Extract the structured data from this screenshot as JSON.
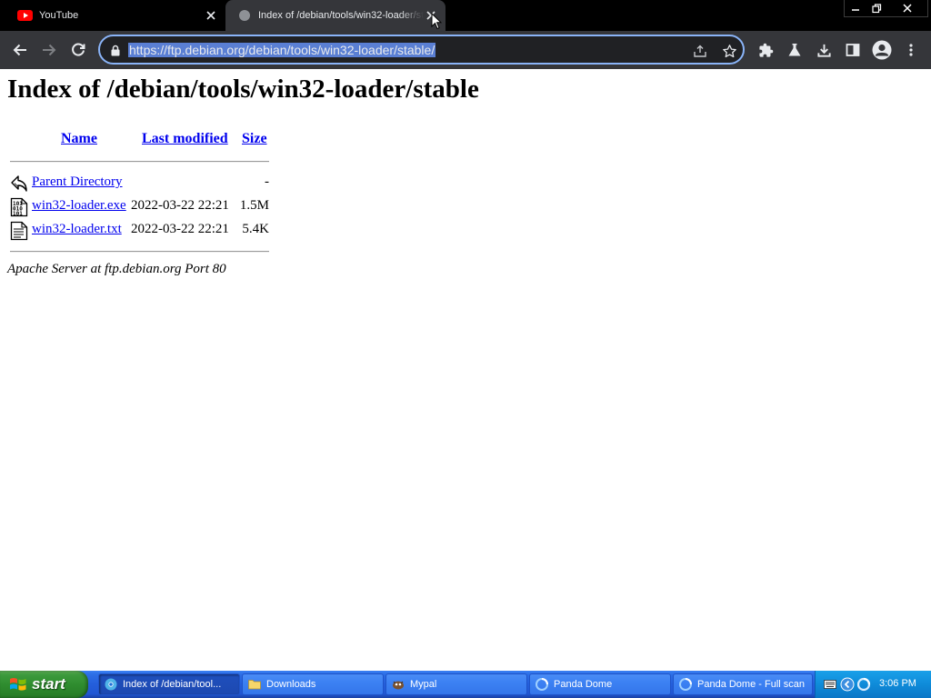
{
  "browser": {
    "tabs": [
      {
        "title": "YouTube",
        "icon": "youtube-icon"
      },
      {
        "title": "Index of /debian/tools/win32-loader/stable",
        "icon": "globe-icon"
      }
    ],
    "address": "https://ftp.debian.org/debian/tools/win32-loader/stable/"
  },
  "page": {
    "heading": "Index of /debian/tools/win32-loader/stable",
    "columns": {
      "name": "Name",
      "last_modified": "Last modified",
      "size": "Size"
    },
    "rows": [
      {
        "icon": "back-icon",
        "name": "Parent Directory",
        "modified": "",
        "size": "-"
      },
      {
        "icon": "binary-file-icon",
        "name": "win32-loader.exe",
        "modified": "2022-03-22 22:21",
        "size": "1.5M"
      },
      {
        "icon": "text-file-icon",
        "name": "win32-loader.txt",
        "modified": "2022-03-22 22:21",
        "size": "5.4K"
      }
    ],
    "footer": "Apache Server at ftp.debian.org Port 80"
  },
  "taskbar": {
    "start_label": "start",
    "tasks": [
      {
        "label": "Index of /debian/tool...",
        "icon": "chrome-icon",
        "active": true
      },
      {
        "label": "Downloads",
        "icon": "folder-icon",
        "active": false
      },
      {
        "label": "Mypal",
        "icon": "mypal-icon",
        "active": false
      },
      {
        "label": "Panda Dome",
        "icon": "panda-icon",
        "active": false
      },
      {
        "label": "Panda Dome - Full scan",
        "icon": "panda-icon",
        "active": false
      }
    ],
    "clock": "3:06 PM"
  },
  "colors": {
    "link": "#0000ee",
    "omnibox_focus": "#8ab4f8",
    "url_selection": "#5a7fd4",
    "taskbar_blue": "#245edb",
    "start_green": "#2e8b2e"
  }
}
